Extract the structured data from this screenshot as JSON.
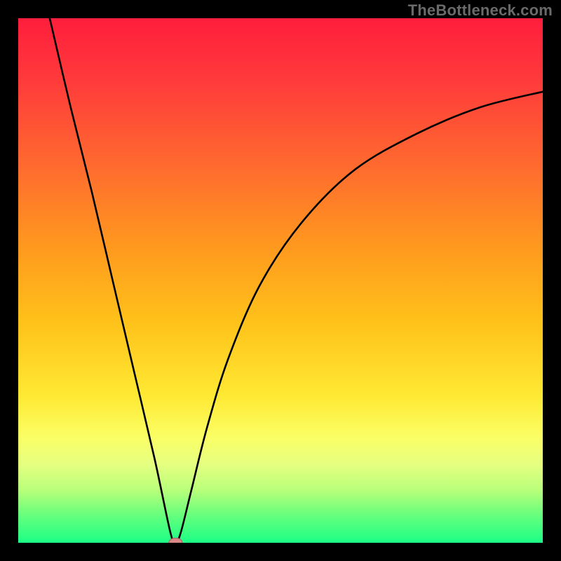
{
  "watermark": "TheBottleneck.com",
  "colors": {
    "frame": "#000000",
    "curve": "#000000",
    "marker_fill": "#d98888",
    "marker_stroke": "#b06868",
    "gradient_stops": [
      {
        "offset": "0%",
        "color": "#ff1e3c"
      },
      {
        "offset": "12%",
        "color": "#ff3b3b"
      },
      {
        "offset": "28%",
        "color": "#ff6a2f"
      },
      {
        "offset": "44%",
        "color": "#ff9a1e"
      },
      {
        "offset": "58%",
        "color": "#ffc21a"
      },
      {
        "offset": "72%",
        "color": "#ffe933"
      },
      {
        "offset": "80%",
        "color": "#faff66"
      },
      {
        "offset": "85%",
        "color": "#e6ff80"
      },
      {
        "offset": "90%",
        "color": "#b8ff7a"
      },
      {
        "offset": "95%",
        "color": "#62ff7d"
      },
      {
        "offset": "100%",
        "color": "#1cff86"
      }
    ]
  },
  "chart_data": {
    "type": "line",
    "title": "",
    "xlabel": "",
    "ylabel": "",
    "xlim": [
      0,
      100
    ],
    "ylim": [
      0,
      100
    ],
    "notch": {
      "x": 30,
      "y": 0
    },
    "series": [
      {
        "name": "bottleneck-curve",
        "points": [
          {
            "x": 6,
            "y": 100
          },
          {
            "x": 10,
            "y": 83
          },
          {
            "x": 14,
            "y": 67
          },
          {
            "x": 18,
            "y": 50
          },
          {
            "x": 22,
            "y": 33
          },
          {
            "x": 26,
            "y": 16
          },
          {
            "x": 29,
            "y": 2
          },
          {
            "x": 30,
            "y": 0
          },
          {
            "x": 31,
            "y": 2
          },
          {
            "x": 33,
            "y": 10
          },
          {
            "x": 36,
            "y": 22
          },
          {
            "x": 40,
            "y": 35
          },
          {
            "x": 46,
            "y": 49
          },
          {
            "x": 54,
            "y": 61
          },
          {
            "x": 64,
            "y": 71
          },
          {
            "x": 76,
            "y": 78
          },
          {
            "x": 88,
            "y": 83
          },
          {
            "x": 100,
            "y": 86
          }
        ]
      }
    ],
    "marker": {
      "x": 30,
      "y": 0,
      "rx": 1.3,
      "ry": 0.9
    }
  }
}
